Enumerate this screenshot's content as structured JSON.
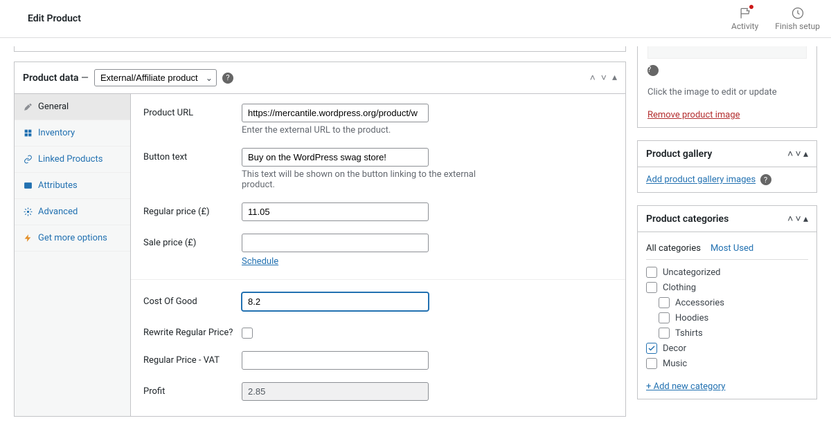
{
  "topbar": {
    "title": "Edit Product",
    "activity_label": "Activity",
    "finish_label": "Finish setup"
  },
  "product_data": {
    "title_prefix": "Product data",
    "title_dash": "—",
    "type_select": "External/Affiliate product",
    "tabs": {
      "general": "General",
      "inventory": "Inventory",
      "linked": "Linked Products",
      "attributes": "Attributes",
      "advanced": "Advanced",
      "more": "Get more options"
    },
    "fields": {
      "product_url_label": "Product URL",
      "product_url_value": "https://mercantile.wordpress.org/product/w",
      "product_url_help": "Enter the external URL to the product.",
      "button_text_label": "Button text",
      "button_text_value": "Buy on the WordPress swag store!",
      "button_text_help": "This text will be shown on the button linking to the external product.",
      "regular_price_label": "Regular price (£)",
      "regular_price_value": "11.05",
      "sale_price_label": "Sale price (£)",
      "sale_price_value": "",
      "schedule_label": "Schedule",
      "cost_of_good_label": "Cost Of Good",
      "cost_of_good_value": "8.2",
      "rewrite_regular_label": "Rewrite Regular Price?",
      "regular_vat_label": "Regular Price - VAT",
      "regular_vat_value": "",
      "profit_label": "Profit",
      "profit_value": "2.85"
    }
  },
  "image_box": {
    "help": "Click the image to edit or update",
    "remove": "Remove product image"
  },
  "gallery": {
    "title": "Product gallery",
    "add_link": "Add product gallery images"
  },
  "categories": {
    "title": "Product categories",
    "tab_all": "All categories",
    "tab_most": "Most Used",
    "items": {
      "uncategorized": "Uncategorized",
      "clothing": "Clothing",
      "accessories": "Accessories",
      "hoodies": "Hoodies",
      "tshirts": "Tshirts",
      "decor": "Decor",
      "music": "Music"
    },
    "add_new": "+ Add new category"
  }
}
